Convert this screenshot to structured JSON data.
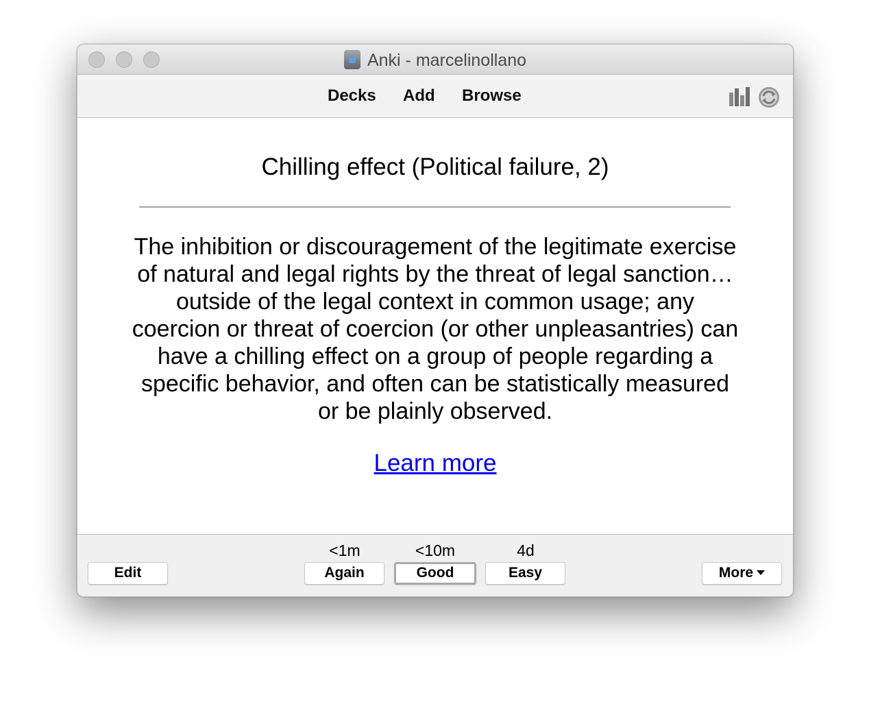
{
  "window": {
    "title": "Anki - marcelinollano"
  },
  "toolbar": {
    "decks_label": "Decks",
    "add_label": "Add",
    "browse_label": "Browse",
    "icons": [
      "stats-icon",
      "sync-icon"
    ]
  },
  "card": {
    "question": "Chilling effect (Political failure, 2)",
    "answer": "The inhibition or discouragement of the legitimate exercise of natural and legal rights by the threat of legal sanction… outside of the legal context in common usage; any coercion or threat of coercion (or other unpleasantries) can have a chilling effect on a group of people regarding a specific behavior, and often can be statistically measured or be plainly observed.",
    "answer_lines": [
      "The inhibition or discouragement of the legitimate exercise",
      "of natural and legal rights by the threat of legal sanction…",
      "outside of the legal context in common usage; any",
      "coercion or threat of coercion (or other unpleasantries) can",
      "have a chilling effect on a group of people regarding a",
      "specific behavior, and often can be statistically measured",
      "or be plainly observed."
    ],
    "link_label": "Learn more"
  },
  "bottom": {
    "edit_label": "Edit",
    "more_label": "More",
    "answers": [
      {
        "interval": "<1m",
        "label": "Again"
      },
      {
        "interval": "<10m",
        "label": "Good"
      },
      {
        "interval": "4d",
        "label": "Easy"
      }
    ]
  },
  "colors": {
    "link": "#0000ee",
    "toolbar_bg": "#f2f2f2",
    "bottombar_bg": "#f0f0f0"
  }
}
